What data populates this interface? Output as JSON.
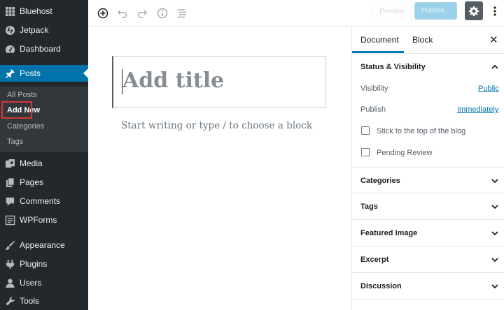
{
  "sidebar": {
    "top_items": [
      {
        "label": "Bluehost",
        "icon": "grid-icon"
      },
      {
        "label": "Jetpack",
        "icon": "jetpack-icon"
      },
      {
        "label": "Dashboard",
        "icon": "dashboard-icon"
      }
    ],
    "posts": {
      "label": "Posts",
      "icon": "pin-icon"
    },
    "submenu": [
      "All Posts",
      "Add New",
      "Categories",
      "Tags"
    ],
    "current_submenu": "Add New",
    "bottom_items": [
      {
        "label": "Media",
        "icon": "media-icon"
      },
      {
        "label": "Pages",
        "icon": "pages-icon"
      },
      {
        "label": "Comments",
        "icon": "comments-icon"
      },
      {
        "label": "WPForms",
        "icon": "wpforms-icon"
      },
      {
        "label": "Appearance",
        "icon": "paintbrush-icon"
      },
      {
        "label": "Plugins",
        "icon": "plugin-icon"
      },
      {
        "label": "Users",
        "icon": "users-icon"
      },
      {
        "label": "Tools",
        "icon": "wrench-icon"
      }
    ],
    "colors": {
      "background": "#23282d",
      "active": "#0073aa",
      "highlight": "#d63638"
    }
  },
  "toolbar": {
    "icons": [
      "add-block-icon",
      "undo-icon",
      "redo-icon",
      "info-icon",
      "block-navigation-icon"
    ],
    "preview_label": "Preview",
    "publish_label": "Publish...",
    "settings_icon": "gear-icon",
    "more_icon": "more-vertical-icon"
  },
  "editor": {
    "title_placeholder": "Add title",
    "body_placeholder": "Start writing or type / to choose a block"
  },
  "panel": {
    "tabs": [
      "Document",
      "Block"
    ],
    "active_tab": "Document",
    "status_visibility": {
      "title": "Status & Visibility",
      "visibility_label": "Visibility",
      "visibility_value": "Public",
      "publish_label": "Publish",
      "publish_value": "Immediately",
      "sticky_label": "Stick to the top of the blog",
      "pending_label": "Pending Review"
    },
    "sections": [
      "Categories",
      "Tags",
      "Featured Image",
      "Excerpt",
      "Discussion"
    ]
  }
}
